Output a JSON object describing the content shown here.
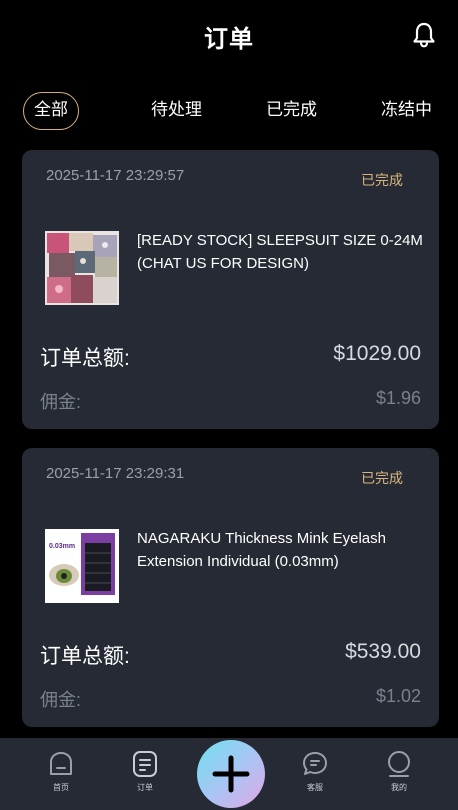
{
  "header": {
    "title": "订单"
  },
  "tabs": [
    {
      "label": "全部",
      "active": true
    },
    {
      "label": "待处理",
      "active": false
    },
    {
      "label": "已完成",
      "active": false
    },
    {
      "label": "冻结中",
      "active": false
    }
  ],
  "orders": [
    {
      "date": "2025-11-17 23:29:57",
      "status": "已完成",
      "product_name": "[READY STOCK] SLEEPSUIT SIZE 0-24M (CHAT US FOR DESIGN)",
      "total_label": "订单总额:",
      "total_value": "$1029.00",
      "commission_label": "佣金:",
      "commission_value": "$1.96"
    },
    {
      "date": "2025-11-17 23:29:31",
      "status": "已完成",
      "product_name": "NAGARAKU Thickness Mink Eyelash Extension Individual (0.03mm)",
      "thumb_text": "0.03mm",
      "total_label": "订单总额:",
      "total_value": "$539.00",
      "commission_label": "佣金:",
      "commission_value": "$1.02"
    }
  ],
  "nav": {
    "home": "首页",
    "orders": "订单",
    "service": "客服",
    "mine": "我的"
  },
  "colors": {
    "accent": "#d8b57c",
    "card": "#252a34",
    "background": "#000000"
  }
}
